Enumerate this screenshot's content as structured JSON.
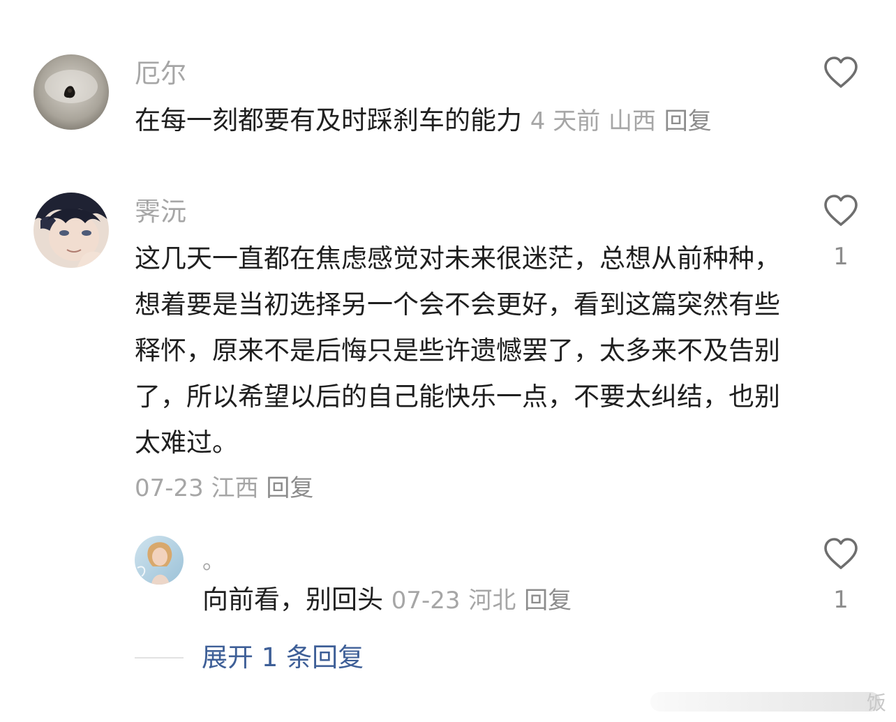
{
  "comments": [
    {
      "username": "厄尔",
      "text": "在每一刻都要有及时踩刹车的能力",
      "time": "4 天前",
      "location": "山西",
      "reply_label": "回复",
      "like_count": ""
    },
    {
      "username": "霁沅",
      "text": "这几天一直都在焦虑感觉对未来很迷茫，总想从前种种，想着要是当初选择另一个会不会更好，看到这篇突然有些释怀，原来不是后悔只是些许遗憾罢了，太多来不及告别了，所以希望以后的自己能快乐一点，不要太纠结，也别太难过。",
      "time": "07-23",
      "location": "江西",
      "reply_label": "回复",
      "like_count": "1"
    }
  ],
  "sub_comment": {
    "username": "。",
    "text": "向前看，别回头",
    "time": "07-23",
    "location": "河北",
    "reply_label": "回复",
    "like_count": "1"
  },
  "expand": {
    "label": "展开 1 条回复"
  },
  "watermark": {
    "text": "饭"
  },
  "colors": {
    "meta_gray": "#a6a6a6",
    "link_blue": "#3e5f97",
    "text": "#1f1f1f"
  },
  "icons": {
    "like": "heart-outline-icon"
  }
}
